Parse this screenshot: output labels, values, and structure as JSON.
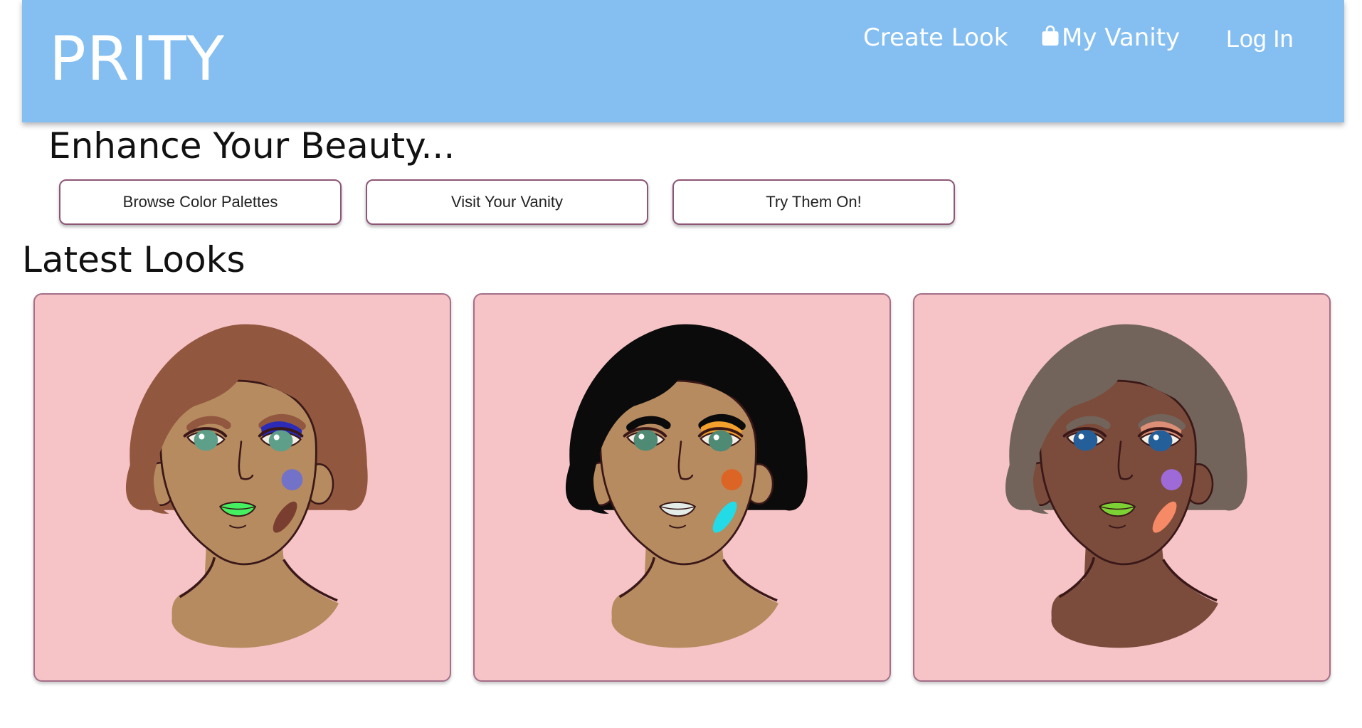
{
  "navbar": {
    "brand": "PRITY",
    "links": [
      {
        "label": "Create Look"
      },
      {
        "label": "My Vanity",
        "icon": "shopping-bag-icon"
      },
      {
        "label": "Log In"
      }
    ],
    "color": "#85bff2"
  },
  "hero": {
    "tagline": "Enhance Your Beauty...",
    "buttons": [
      {
        "label": "Browse Color Palettes"
      },
      {
        "label": "Visit Your Vanity"
      },
      {
        "label": "Try Them On!"
      }
    ]
  },
  "latest": {
    "title": "Latest Looks",
    "card_background": "#f6c4c7",
    "looks": [
      {
        "hair": "#92573f",
        "skin": "#b68b60",
        "iris": "#5e9f8a",
        "eyeshadow": "#2b2bb8",
        "lips": "#44f060",
        "blush": "#7272c8",
        "contour": "#7a3e30"
      },
      {
        "hair": "#0b0b0b",
        "skin": "#b68b60",
        "iris": "#4e8a74",
        "eyeshadow": "#f3a02c",
        "lips": "#e4ece8",
        "blush": "#dc6424",
        "contour": "#22dbe6"
      },
      {
        "hair": "#72645a",
        "skin": "#7b4c3c",
        "iris": "#245f9a",
        "eyeshadow": "#dd8e76",
        "lips": "#7cd234",
        "blush": "#9e6ad8",
        "contour": "#f68a66"
      }
    ]
  }
}
